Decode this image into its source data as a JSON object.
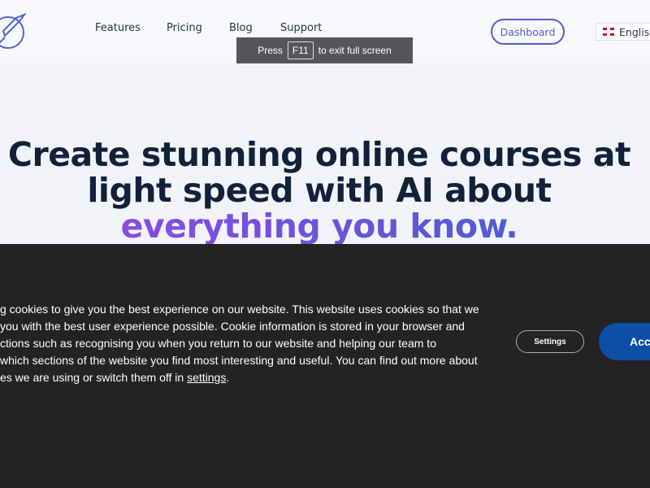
{
  "header": {
    "nav": [
      "Features",
      "Pricing",
      "Blog",
      "Support"
    ],
    "dashboard": "Dashboard",
    "language": "English"
  },
  "fullscreen": {
    "press": "Press",
    "key": "F11",
    "rest": "to exit full screen"
  },
  "hero": {
    "line1": "Create stunning online courses at",
    "line2": "light speed with AI about",
    "line3": "everything you know."
  },
  "cookie": {
    "lines": [
      "g cookies to give you the best experience on our website. This website uses cookies so that we",
      "you with the best user experience possible. Cookie information is stored in your browser and",
      "ctions such as recognising you when you return to our website and helping our team to",
      "which sections of the website you find most interesting and useful. You can find out more about",
      "es we are using or switch them off in "
    ],
    "link": "settings",
    "end": ".",
    "settings_btn": "Settings",
    "accept_btn": "Acc"
  }
}
